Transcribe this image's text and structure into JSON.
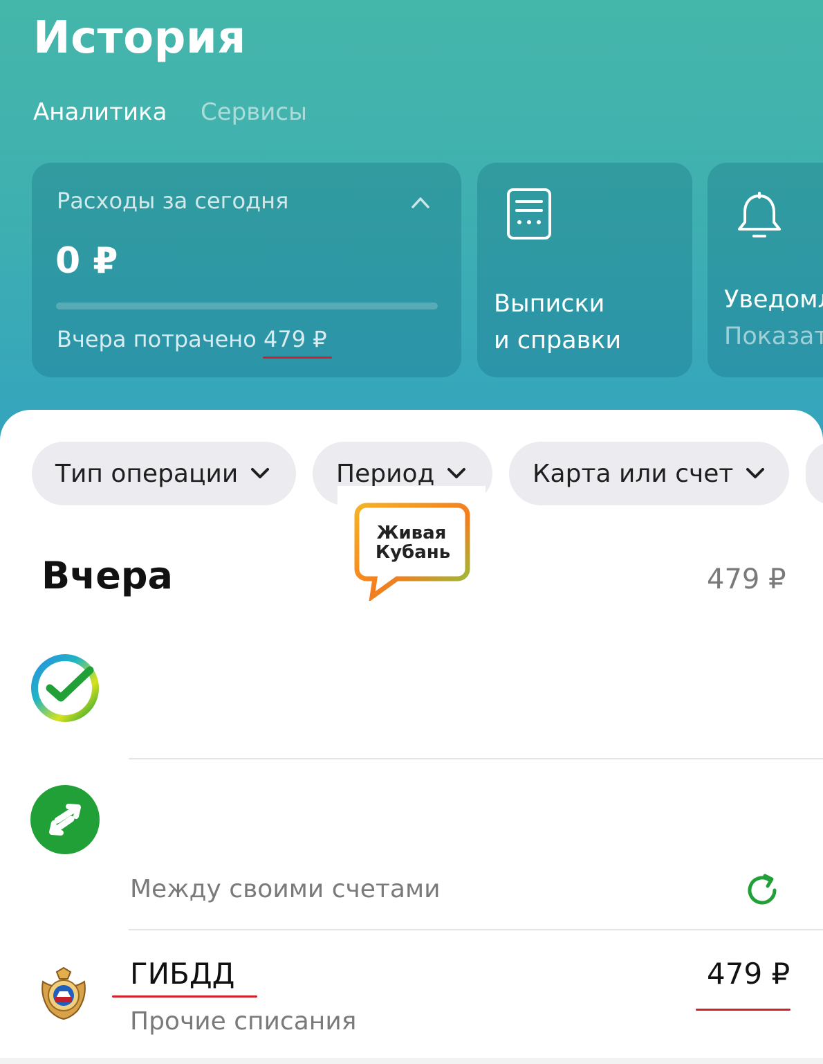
{
  "header": {
    "title": "История",
    "tabs": [
      {
        "label": "Аналитика",
        "active": true
      },
      {
        "label": "Сервисы",
        "active": false
      }
    ]
  },
  "spend_card": {
    "label": "Расходы за сегодня",
    "amount": "0 ₽",
    "progress_fraction": 0,
    "yesterday_prefix": "Вчера потрачено",
    "yesterday_amount": "479 ₽"
  },
  "statements_card": {
    "line1": "Выписки",
    "line2": "и справки",
    "icon": "document-icon"
  },
  "notifications_card": {
    "title": "Уведомл",
    "subtitle": "Показат",
    "icon": "bell-icon"
  },
  "filters": [
    {
      "label": "Тип операции"
    },
    {
      "label": "Период"
    },
    {
      "label": "Карта или счет"
    }
  ],
  "watermark": {
    "text": "Живая Кубань",
    "colors": [
      "#f5a623",
      "#f57c1f",
      "#8cc63f"
    ]
  },
  "day_group": {
    "title": "Вчера",
    "total": "479 ₽"
  },
  "transactions": [
    {
      "icon": "sber-check-icon",
      "title": "",
      "subtitle": "",
      "amount": ""
    },
    {
      "icon": "transfer-arrows-icon",
      "title": "",
      "subtitle": "Между своими счетами",
      "action_icon": "repeat-icon"
    },
    {
      "icon": "gibdd-emblem-icon",
      "title": "ГИБДД",
      "subtitle": "Прочие списания",
      "amount": "479 ₽"
    }
  ],
  "colors": {
    "header_top": "#45b6aa",
    "header_bottom": "#33a3bf",
    "brand_green": "#21a038",
    "annotation_red": "#d0202a"
  }
}
